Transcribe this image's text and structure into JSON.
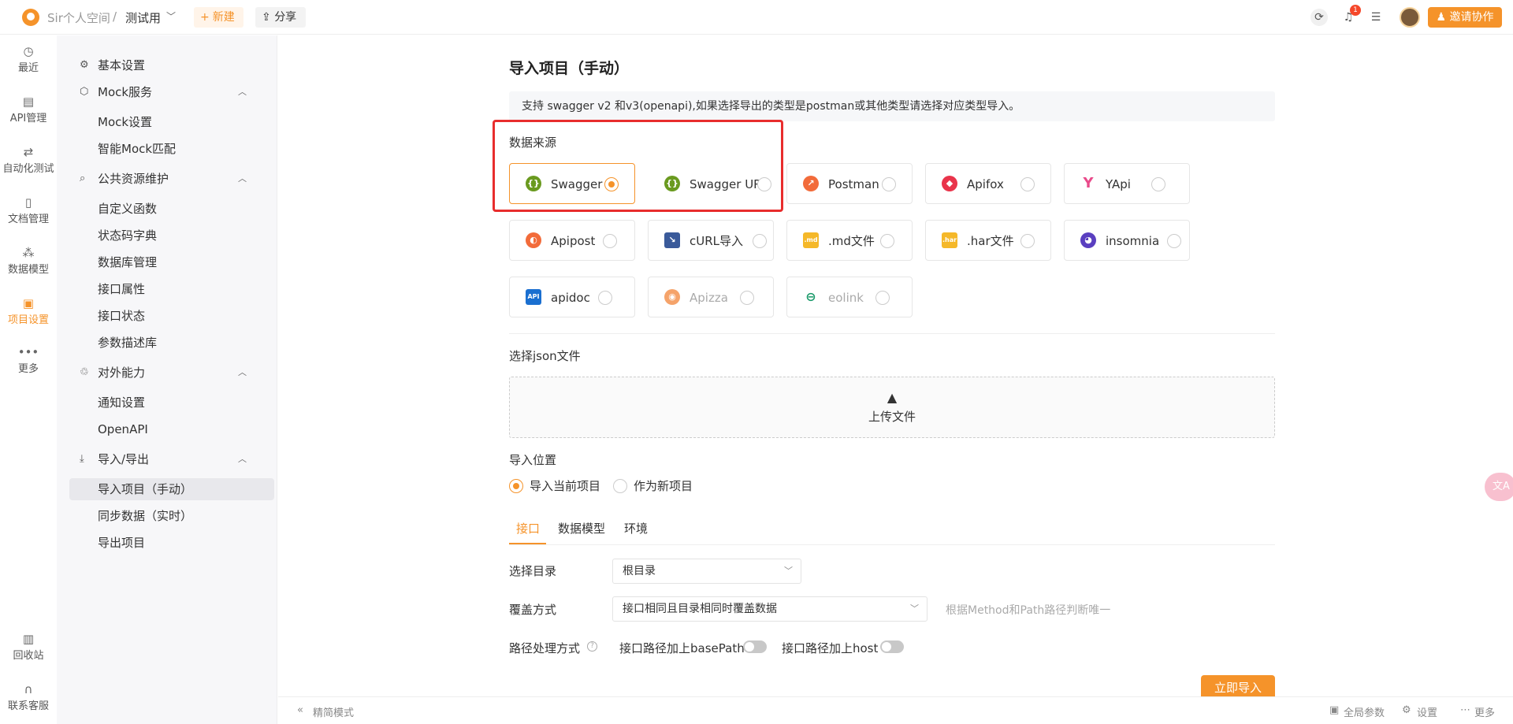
{
  "topbar": {
    "space": "Sir个人空间",
    "separator": "/",
    "project": "测试用",
    "new_label": "新建",
    "share_label": "分享",
    "notification_count": "1",
    "invite_label": "邀请协作"
  },
  "rail": {
    "recent": "最近",
    "api": "API管理",
    "auto": "自动化测试",
    "docs": "文档管理",
    "model": "数据模型",
    "project_settings": "项目设置",
    "more": "更多",
    "trash": "回收站",
    "support": "联系客服"
  },
  "subnav": {
    "basic": "基本设置",
    "mock": "Mock服务",
    "mock_settings": "Mock设置",
    "smart_mock": "智能Mock匹配",
    "public": "公共资源维护",
    "custom_func": "自定义函数",
    "status_dict": "状态码字典",
    "db": "数据库管理",
    "api_attr": "接口属性",
    "api_status": "接口状态",
    "param_desc": "参数描述库",
    "external": "对外能力",
    "notify": "通知设置",
    "openapi": "OpenAPI",
    "import_export": "导入/导出",
    "import_manual": "导入项目（手动）",
    "sync_data": "同步数据（实时）",
    "export": "导出项目"
  },
  "main": {
    "title": "导入项目（手动）",
    "notice": "支持 swagger v2 和v3(openapi),如果选择导出的类型是postman或其他类型请选择对应类型导入。",
    "data_source_label": "数据来源",
    "sources": [
      {
        "label": "Swagger",
        "selected": true
      },
      {
        "label": "Swagger URL",
        "selected": false
      },
      {
        "label": "Postman",
        "selected": false
      },
      {
        "label": "Apifox",
        "selected": false
      },
      {
        "label": "YApi",
        "selected": false
      },
      {
        "label": "Apipost",
        "selected": false
      },
      {
        "label": "cURL导入",
        "selected": false
      },
      {
        "label": ".md文件",
        "selected": false
      },
      {
        "label": ".har文件",
        "selected": false
      },
      {
        "label": "insomnia",
        "selected": false
      },
      {
        "label": "apidoc",
        "selected": false
      },
      {
        "label": "Apizza",
        "selected": false
      },
      {
        "label": "eolink",
        "selected": false
      }
    ],
    "json_label": "选择json文件",
    "upload_label": "上传文件",
    "position_label": "导入位置",
    "position_current": "导入当前项目",
    "position_new": "作为新项目",
    "tabs": [
      "接口",
      "数据模型",
      "环境"
    ],
    "dir_label": "选择目录",
    "dir_value": "根目录",
    "cover_label": "覆盖方式",
    "cover_value": "接口相同且目录相同时覆盖数据",
    "cover_hint": "根据Method和Path路径判断唯一",
    "path_label": "路径处理方式",
    "base_path_label": "接口路径加上basePath",
    "host_label": "接口路径加上host",
    "import_btn": "立即导入"
  },
  "bottombar": {
    "simple": "精简模式",
    "globals": "全局参数",
    "settings": "设置",
    "more": "更多"
  },
  "colors": {
    "accent": "#f5932a",
    "highlight_box": "#e82d2d"
  }
}
